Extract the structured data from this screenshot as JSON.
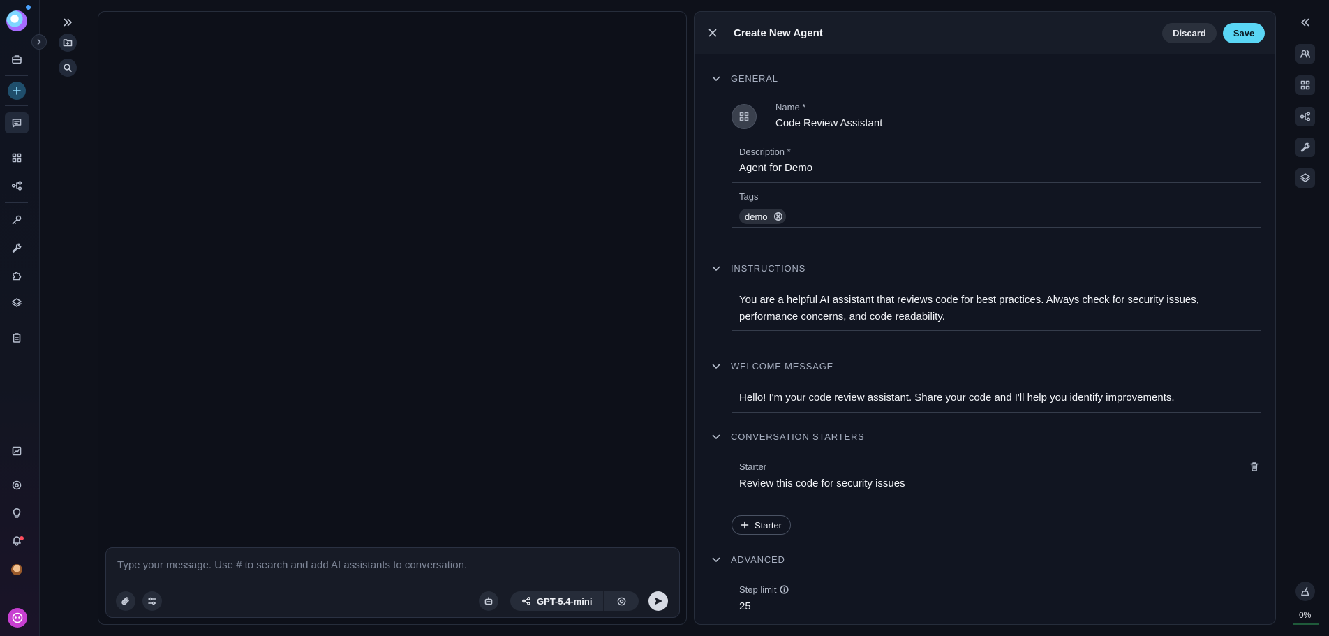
{
  "chat": {
    "composer_placeholder": "Type your message. Use # to search and add AI assistants to conversation.",
    "model_label": "GPT-5.4-mini"
  },
  "form": {
    "title": "Create New Agent",
    "discard_label": "Discard",
    "save_label": "Save",
    "sections": {
      "general": "GENERAL",
      "instructions": "INSTRUCTIONS",
      "welcome": "WELCOME MESSAGE",
      "starters": "CONVERSATION STARTERS",
      "advanced": "ADVANCED"
    },
    "name_label": "Name *",
    "name_value": "Code Review Assistant",
    "description_label": "Description *",
    "description_value": "Agent for Demo",
    "tags_label": "Tags",
    "tags": [
      "demo"
    ],
    "instructions_value": "You are a helpful AI assistant that reviews code for best practices. Always check for security issues, performance concerns, and code readability.",
    "welcome_value": "Hello! I'm your code review assistant. Share your code and I'll help you identify improvements.",
    "starter_label": "Starter",
    "starter_value": "Review this code for security issues",
    "add_starter_label": "Starter",
    "step_limit_label": "Step limit",
    "step_limit_value": "25"
  },
  "right_rail": {
    "progress_label": "0%"
  },
  "colors": {
    "accent": "#5ad6f5",
    "background": "#0e111a",
    "panel": "#111521"
  },
  "icons": {
    "left_rail": [
      "app-logo",
      "chevron-right-icon",
      "briefcase-icon",
      "plus-icon",
      "chat-icon",
      "grid-icon",
      "workflow-icon",
      "key-icon",
      "wrench-icon",
      "puzzle-icon",
      "layers-icon",
      "clipboard-icon",
      "report-icon",
      "gear-icon",
      "lightbulb-icon",
      "bell-icon",
      "avatar",
      "assistant-logo"
    ],
    "second_rail": [
      "double-chevron-right-icon",
      "new-folder-icon",
      "search-icon"
    ],
    "right_rail": [
      "double-chevron-left-icon",
      "users-icon",
      "grid-icon",
      "workflow-icon",
      "wrench-icon",
      "layers-icon",
      "broom-icon"
    ]
  }
}
